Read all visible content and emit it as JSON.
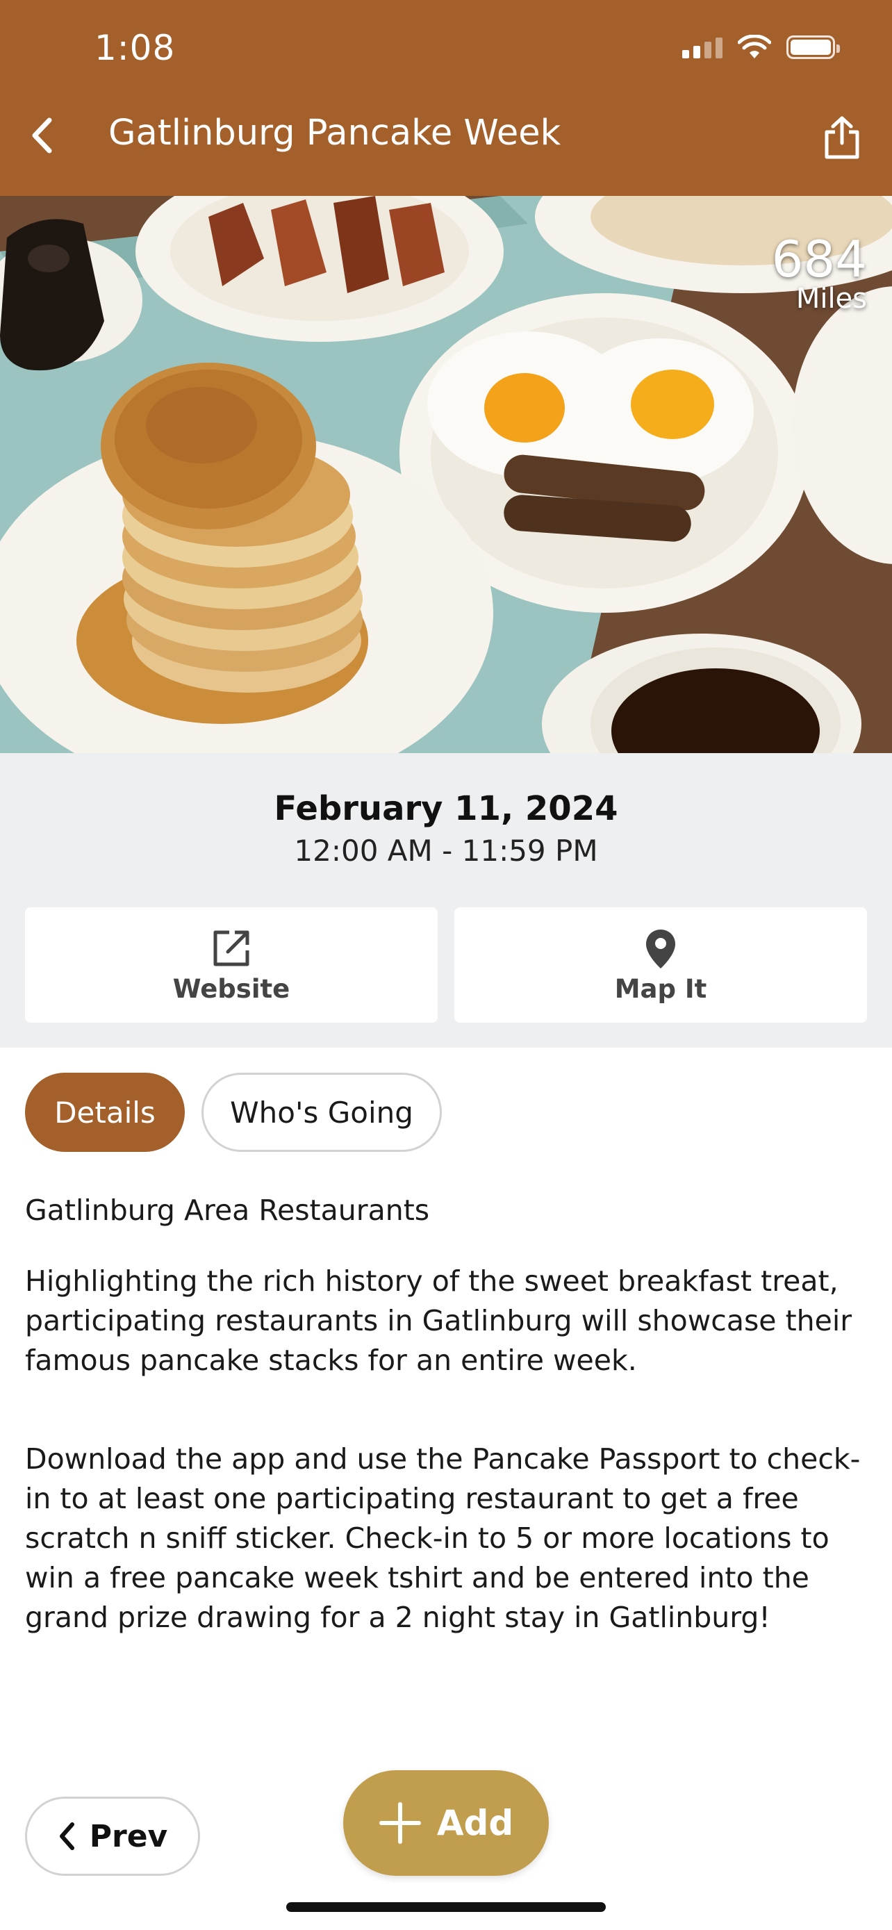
{
  "status_bar": {
    "time": "1:08"
  },
  "nav": {
    "title": "Gatlinburg Pancake Week",
    "back_icon": "chevron-left-icon",
    "share_icon": "share-icon"
  },
  "hero": {
    "distance_value": "684",
    "distance_unit": "Miles"
  },
  "event": {
    "date": "February 11, 2024",
    "time_range": "12:00 AM - 11:59 PM"
  },
  "actions": [
    {
      "label": "Website",
      "icon": "external-link-icon"
    },
    {
      "label": "Map It",
      "icon": "map-pin-icon"
    }
  ],
  "tabs": [
    {
      "label": "Details",
      "active": true
    },
    {
      "label": "Who's Going",
      "active": false
    }
  ],
  "details": {
    "venue": "Gatlinburg Area Restaurants",
    "paragraph_1": "Highlighting the rich history of the sweet breakfast treat, participating restaurants in Gatlinburg will showcase their famous pancake stacks for an entire week.",
    "paragraph_2": "Download the app and use the Pancake Passport to check-in to at least one participating restaurant to get a free scratch n sniff sticker. Check-in to 5 or more locations to win a free pancake week tshirt and be entered into the grand prize drawing for a 2 night stay in Gatlinburg!"
  },
  "bottom": {
    "prev_label": "Prev",
    "add_label": "Add"
  },
  "colors": {
    "header_brown": "#a3602b",
    "add_gold": "#c19e4e",
    "panel_gray": "#eeeff1"
  }
}
